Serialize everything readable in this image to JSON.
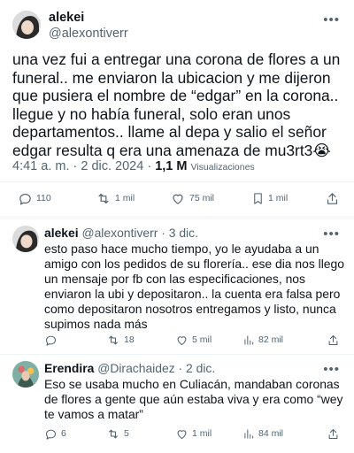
{
  "main_tweet": {
    "author_name": "alekei",
    "author_handle": "@alexontiverr",
    "more": "•••",
    "text": "una vez fui a entregar una corona de flores a un funeral.. me enviaron la ubicacion y me dijeron que pusiera el nombre de “edgar” en la corona.. llegue y no había funeral, solo eran unos departamentos.. llame al depa y salio el señor edgar resulta q era una amenaza de mu3rt3😭",
    "timestamp": "4:41 a. m. · 2 dic. 2024 ·",
    "views_count": "1,1 M",
    "views_label": "Visualizaciones",
    "actions": {
      "replies": "110",
      "retweets": "1 mil",
      "likes": "75 mil",
      "bookmarks": "1 mil"
    }
  },
  "replies": [
    {
      "author_name": "alekei",
      "author_handle": "@alexontiverr · 3 dic.",
      "more": "•••",
      "text": "esto paso hace mucho tiempo, yo le ayudaba a un amigo con los pedidos de su florería.. ese dia nos llego un mensaje por fb con las especificaciones, nos enviaron la ubi y depositaron.. la cuenta era falsa pero como depositaron nosotros entregamos y listo, nunca supimos nada más",
      "actions": {
        "replies": "",
        "retweets": "18",
        "likes": "5 mil",
        "views": "82 mil"
      }
    },
    {
      "author_name": "Erendira",
      "author_handle": "@Dirachaidez · 2 dic.",
      "more": "•••",
      "text": "Eso se usaba mucho en Culiacán, mandaban coronas de flores a gente que aún estaba viva y era como “wey te vamos a matar”",
      "actions": {
        "replies": "6",
        "retweets": "5",
        "likes": "1 mil",
        "views": "84 mil"
      }
    }
  ]
}
